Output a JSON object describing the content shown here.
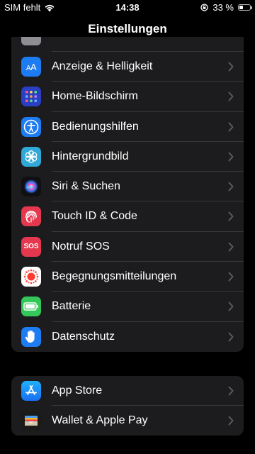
{
  "status_bar": {
    "carrier": "SIM fehlt",
    "time": "14:38",
    "battery_percent": "33 %",
    "battery_level": 0.33
  },
  "nav": {
    "title": "Einstellungen"
  },
  "groups": [
    {
      "items": [
        {
          "label": "Anzeige & Helligkeit",
          "icon": "display-brightness-icon",
          "color": "#1e7cf2"
        },
        {
          "label": "Home-Bildschirm",
          "icon": "home-screen-grid-icon",
          "color": "#2b3fc5"
        },
        {
          "label": "Bedienungshilfen",
          "icon": "accessibility-icon",
          "color": "#1e7cf2"
        },
        {
          "label": "Hintergrundbild",
          "icon": "wallpaper-flower-icon",
          "color": "#30a8d8"
        },
        {
          "label": "Siri & Suchen",
          "icon": "siri-icon",
          "color": "#101014"
        },
        {
          "label": "Touch ID & Code",
          "icon": "fingerprint-icon",
          "color": "#e5384f"
        },
        {
          "label": "Notruf SOS",
          "icon": "sos-icon",
          "color": "#e5384f",
          "icon_text": "SOS"
        },
        {
          "label": "Begegnungsmitteilungen",
          "icon": "exposure-notification-icon",
          "color": "#ffffff"
        },
        {
          "label": "Batterie",
          "icon": "battery-icon",
          "color": "#34c759"
        },
        {
          "label": "Datenschutz",
          "icon": "privacy-hand-icon",
          "color": "#1e7cf2"
        }
      ]
    },
    {
      "items": [
        {
          "label": "App Store",
          "icon": "app-store-icon",
          "color": "#1e8ef5"
        },
        {
          "label": "Wallet & Apple Pay",
          "icon": "wallet-icon",
          "color": "#1a1a1a"
        }
      ]
    }
  ]
}
